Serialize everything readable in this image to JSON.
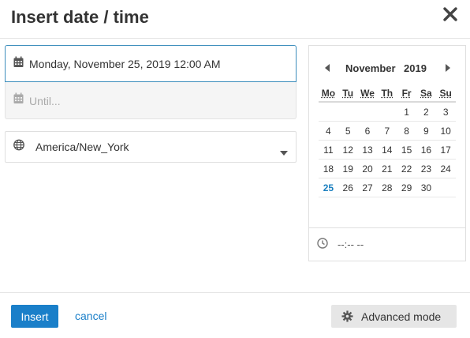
{
  "dialog": {
    "title": "Insert date / time",
    "close_icon": "close-icon"
  },
  "start": {
    "value": "Monday, November 25, 2019 12:00 AM",
    "icon": "calendar-icon"
  },
  "until": {
    "placeholder": "Until...",
    "icon": "calendar-icon"
  },
  "timezone": {
    "value": "America/New_York",
    "icon": "globe-icon",
    "caret_icon": "caret-down-icon"
  },
  "calendar": {
    "month": "November",
    "year": "2019",
    "weekdays": [
      "Mo",
      "Tu",
      "We",
      "Th",
      "Fr",
      "Sa",
      "Su"
    ],
    "weeks": [
      [
        "",
        "",
        "",
        "",
        "1",
        "2",
        "3"
      ],
      [
        "4",
        "5",
        "6",
        "7",
        "8",
        "9",
        "10"
      ],
      [
        "11",
        "12",
        "13",
        "14",
        "15",
        "16",
        "17"
      ],
      [
        "18",
        "19",
        "20",
        "21",
        "22",
        "23",
        "24"
      ],
      [
        "25",
        "26",
        "27",
        "28",
        "29",
        "30",
        ""
      ]
    ],
    "selected_day": "25",
    "accent_color": "#1a7fbf",
    "time_value": "--:-- --",
    "clock_icon": "clock-icon"
  },
  "footer": {
    "insert_label": "Insert",
    "cancel_label": "cancel",
    "advanced_label": "Advanced mode",
    "gear_icon": "gear-icon"
  }
}
